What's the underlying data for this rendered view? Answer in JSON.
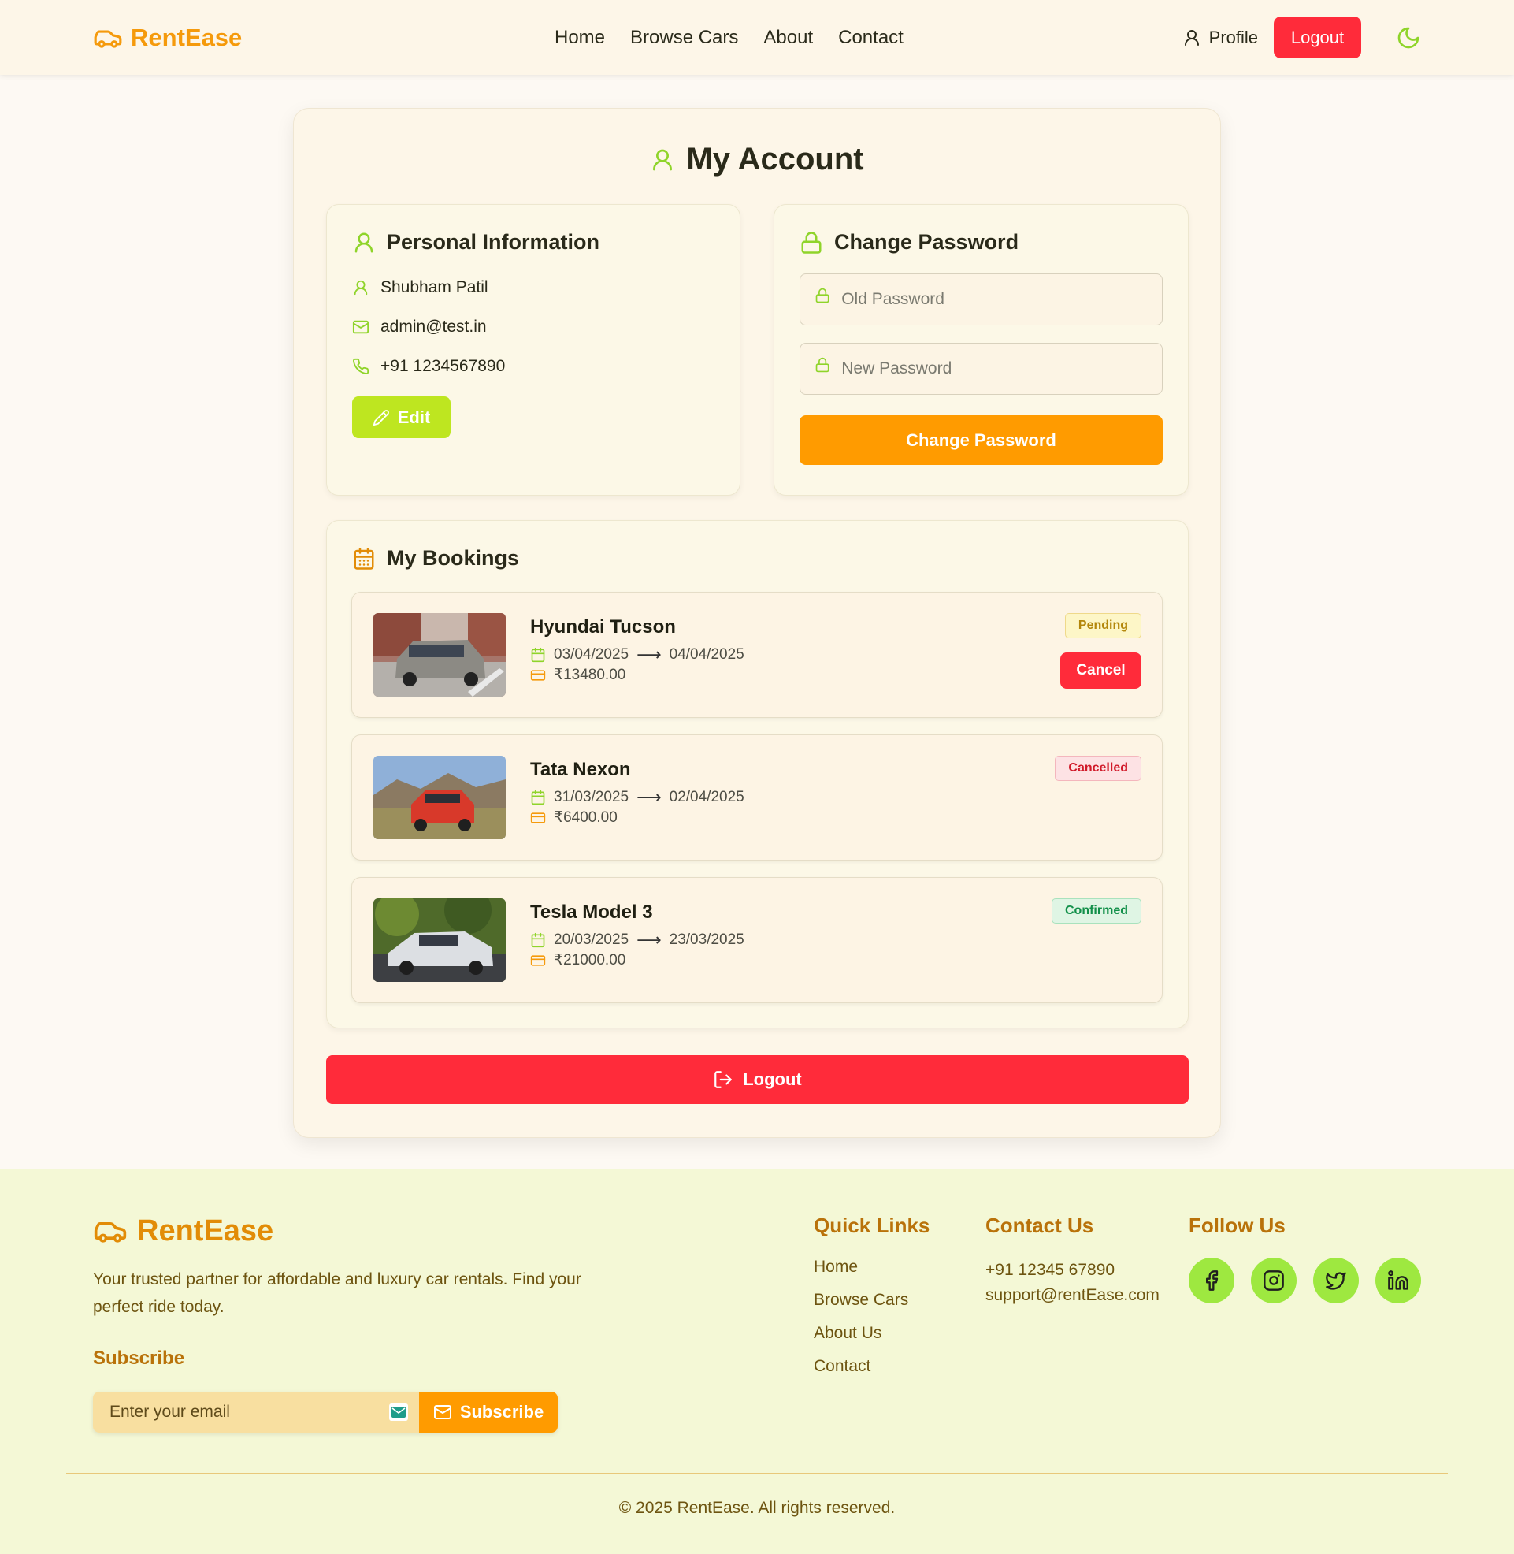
{
  "nav": {
    "brand": "RentEase",
    "links": [
      "Home",
      "Browse Cars",
      "About",
      "Contact"
    ],
    "profile_label": "Profile",
    "logout_label": "Logout"
  },
  "account": {
    "title": "My Account",
    "personal": {
      "title": "Personal Information",
      "name": "Shubham Patil",
      "email": "admin@test.in",
      "phone": "+91 1234567890",
      "edit_label": "Edit"
    },
    "password": {
      "title": "Change Password",
      "old_placeholder": "Old Password",
      "new_placeholder": "New Password",
      "submit_label": "Change Password"
    },
    "bookings": {
      "title": "My Bookings",
      "items": [
        {
          "car": "Hyundai Tucson",
          "start": "03/04/2025",
          "end": "04/04/2025",
          "price": "₹13480.00",
          "status": "Pending",
          "action": "Cancel"
        },
        {
          "car": "Tata Nexon",
          "start": "31/03/2025",
          "end": "02/04/2025",
          "price": "₹6400.00",
          "status": "Cancelled"
        },
        {
          "car": "Tesla Model 3",
          "start": "20/03/2025",
          "end": "23/03/2025",
          "price": "₹21000.00",
          "status": "Confirmed"
        }
      ]
    },
    "logout_label": "Logout"
  },
  "footer": {
    "brand": "RentEase",
    "description": "Your trusted partner for affordable and luxury car rentals. Find your perfect ride today.",
    "subscribe_title": "Subscribe",
    "email_placeholder": "Enter your email",
    "subscribe_label": "Subscribe",
    "quick_links_title": "Quick Links",
    "quick_links": [
      "Home",
      "Browse Cars",
      "About Us",
      "Contact"
    ],
    "contact_title": "Contact Us",
    "contact_phone": "+91 12345 67890",
    "contact_email": "support@rentEase.com",
    "follow_title": "Follow Us",
    "socials": [
      "facebook-icon",
      "instagram-icon",
      "twitter-icon",
      "linkedin-icon"
    ],
    "copyright": "© 2025 RentEase. All rights reserved."
  },
  "colors": {
    "brand_orange": "#f59a0c",
    "accent_green": "#8fd42a",
    "danger_red": "#ff2b3a",
    "button_orange": "#ff9b00"
  }
}
